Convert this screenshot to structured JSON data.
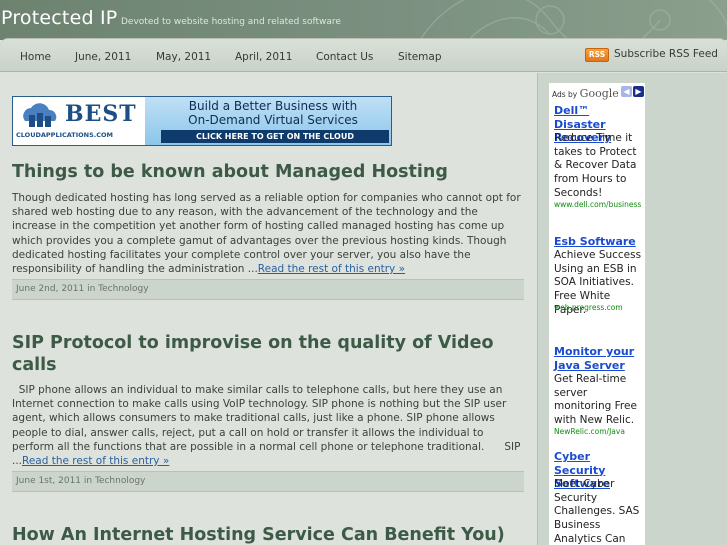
{
  "header": {
    "title": "Protected IP",
    "tagline": "Devoted to website hosting and related software"
  },
  "nav": {
    "items": [
      {
        "label": "Home"
      },
      {
        "label": "June, 2011"
      },
      {
        "label": "May, 2011"
      },
      {
        "label": "April, 2011"
      },
      {
        "label": "Contact Us"
      },
      {
        "label": "Sitemap"
      }
    ],
    "rss_badge": "RSS",
    "rss_label": "Subscribe RSS Feed"
  },
  "banner": {
    "brand": "BEST",
    "domain": "CLOUDAPPLICATIONS.COM",
    "line1": "Build a Better Business with",
    "line2": "On-Demand Virtual Services",
    "cta": "CLICK HERE TO GET ON THE CLOUD"
  },
  "posts": [
    {
      "title": "Things to be known about Managed Hosting",
      "excerpt": "Though dedicated hosting has long served as a reliable option for companies who cannot opt for shared web hosting due to any reason, with the advancement of the technology and the increase in the competition yet another form of hosting called managed hosting has come up which provides you a complete gamut of advantages over the previous hosting kinds. Though dedicated hosting facilitates your complete control over your server, you also have the responsibility of handling the administration ...",
      "more": "Read the rest of this entry »",
      "meta": "June 2nd, 2011 in Technology"
    },
    {
      "title": "SIP Protocol to improvise on the quality of Video calls",
      "excerpt": "  SIP phone allows an individual to make similar calls to telephone calls, but here they use an Internet connection to make calls using VoIP technology. SIP phone is nothing but the SIP user agent, which allows consumers to make traditional calls, just like a phone. SIP phone allows people to dial, answer calls, reject, put a call on hold or transfer it allows the individual to perform all the functions that are possible in a normal cell phone or telephone traditional.      SIP ...",
      "more": "Read the rest of this entry »",
      "meta": "June 1st, 2011 in Technology"
    },
    {
      "title": "How An Internet Hosting Service Can Benefit You)"
    }
  ],
  "ads": {
    "ads_by": "Ads by",
    "google": "Google",
    "items": [
      {
        "title": "Dell™ Disaster Recovery",
        "text": "Reduce Time it takes to Protect & Recover Data from Hours to Seconds!",
        "url": "www.dell.com/business"
      },
      {
        "title": "Esb Software",
        "text": "Achieve Success Using an ESB in SOA Initiatives. Free White Paper.",
        "url": "web.progress.com"
      },
      {
        "title": "Monitor your Java Server",
        "text": "Get Real-time server monitoring Free with New Relic.",
        "url": "NewRelic.com/Java"
      },
      {
        "title": "Cyber Security Software",
        "text": "Meet Cyber Security Challenges. SAS Business Analytics Can",
        "url": ""
      }
    ]
  },
  "colors": {
    "header_bg": "#7b9080",
    "nav_bg": "#d1d9d0",
    "post_title": "#3d5a46",
    "link": "#2a5f9e",
    "ad_title": "#1a4bd0",
    "ad_url": "#128a12",
    "rss_orange": "#f08c2c"
  }
}
